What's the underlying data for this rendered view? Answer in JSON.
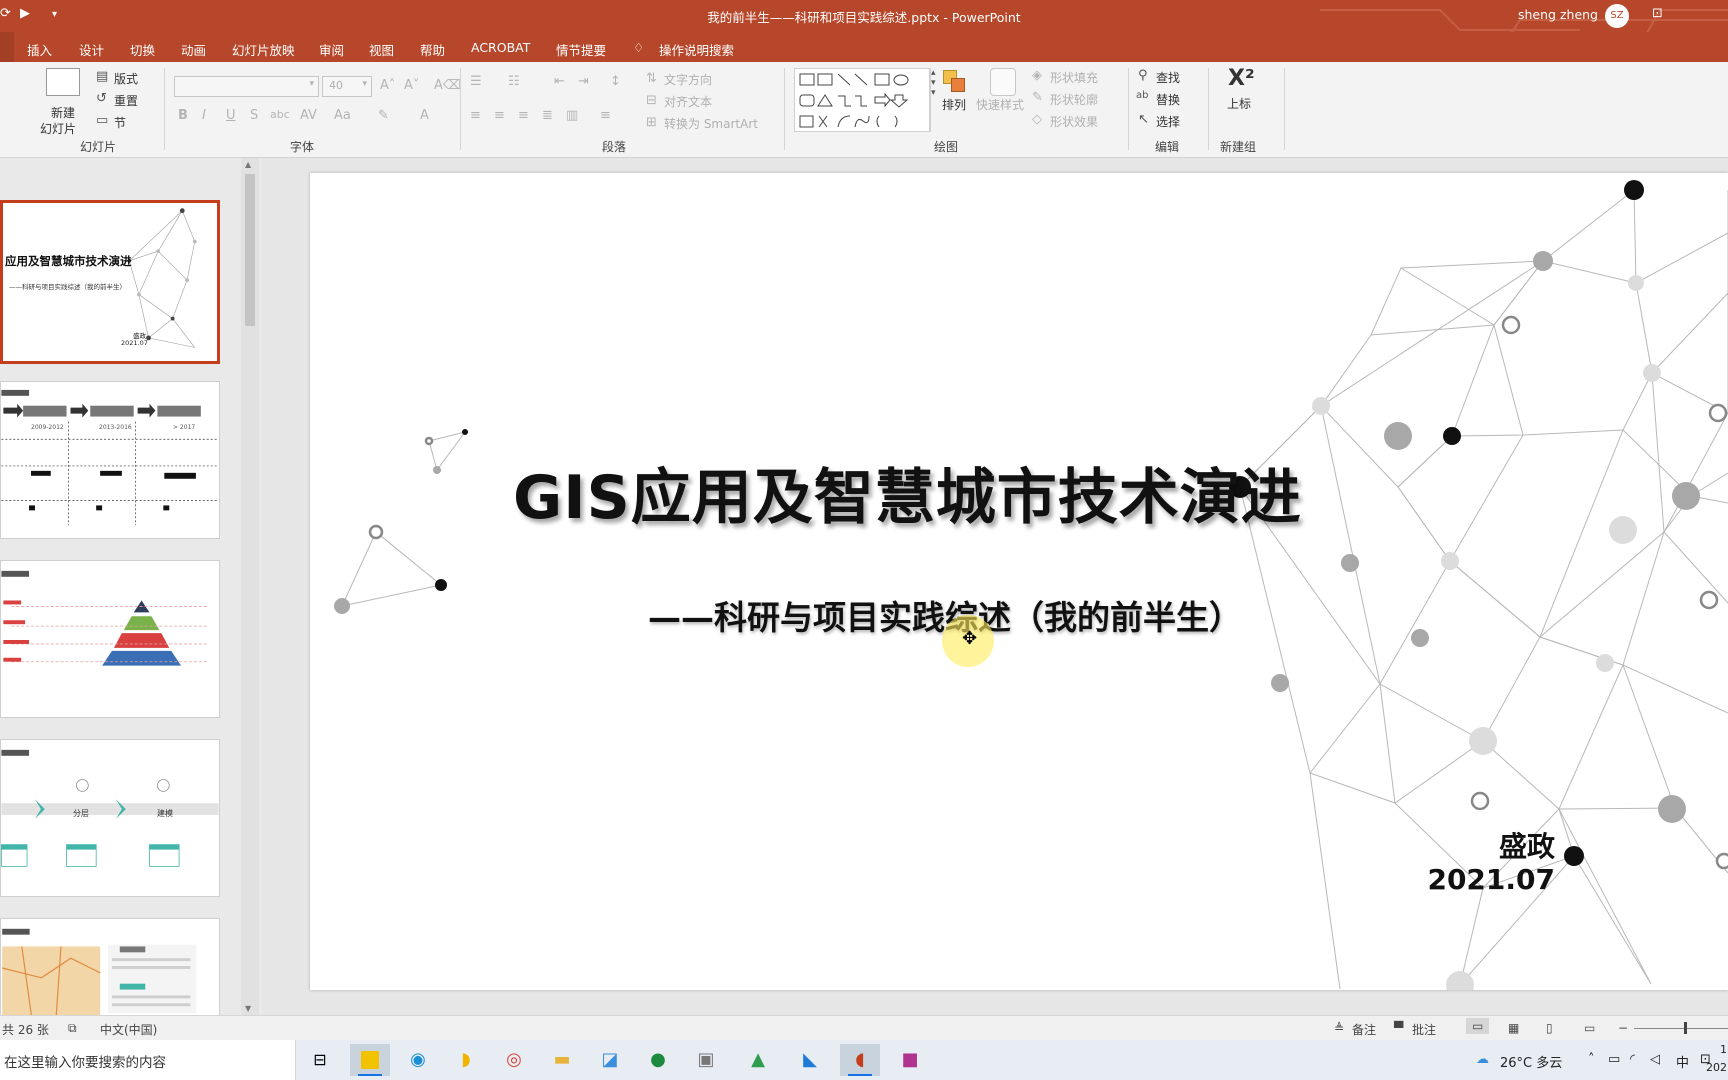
{
  "window": {
    "title": "我的前半生——科研和项目实践综述.pptx  -  PowerPoint",
    "user_name": "sheng zheng",
    "user_initials": "SZ"
  },
  "menu": {
    "tabs": [
      "插入",
      "设计",
      "切换",
      "动画",
      "幻灯片放映",
      "审阅",
      "视图",
      "帮助",
      "ACROBAT",
      "情节提要"
    ],
    "tell_me": "操作说明搜索"
  },
  "ribbon": {
    "slides_group": {
      "label": "幻灯片",
      "new_slide_line1": "新建",
      "new_slide_line2": "幻灯片",
      "layout": "版式",
      "reset": "重置",
      "section": "节"
    },
    "font_group": {
      "label": "字体",
      "font_size": "40"
    },
    "paragraph_group": {
      "label": "段落",
      "text_direction": "文字方向",
      "align_text": "对齐文本",
      "convert_smartart": "转换为 SmartArt"
    },
    "drawing_group": {
      "label": "绘图",
      "arrange": "排列",
      "quick_styles": "快速样式",
      "shape_fill": "形状填充",
      "shape_outline": "形状轮廓",
      "shape_effects": "形状效果"
    },
    "editing_group": {
      "label": "编辑",
      "find": "查找",
      "replace": "替换",
      "select": "选择"
    },
    "new_group": {
      "label": "新建组",
      "superscript": "上标"
    }
  },
  "thumbnails": {
    "slide1_title": "应用及智慧城市技术演进",
    "slide1_subtitle": "——科研与项目实践综述（我的前半生）",
    "slide1_author": "盛政",
    "slide1_date": "2021.07",
    "slide2_periods": [
      "2009-2012",
      "2013-2016",
      "> 2017"
    ],
    "slide4_labels": [
      "分层",
      "建模"
    ]
  },
  "slide": {
    "title": "GIS应用及智慧城市技术演进",
    "subtitle": "——科研与项目实践综述（我的前半生）",
    "author": "盛政",
    "date": "2021.07"
  },
  "statusbar": {
    "slide_count": "共 26 张",
    "language": "中文(中国)",
    "notes": "备注",
    "comments": "批注"
  },
  "taskbar": {
    "search_placeholder": "在这里输入你要搜索的内容",
    "weather": "26°C 多云",
    "ime": "中",
    "clock_top": "1",
    "clock_bottom": "202"
  },
  "colors": {
    "accent": "#b7472a",
    "selected_thumb": "#c43e1c"
  }
}
